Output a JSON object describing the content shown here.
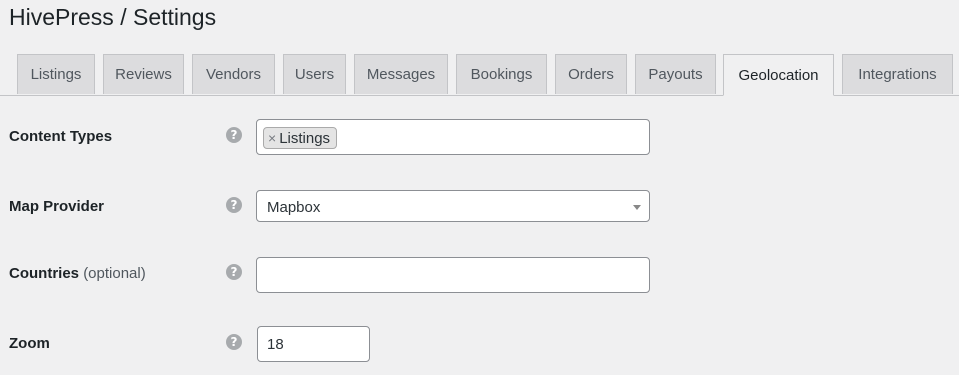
{
  "page": {
    "title": "HivePress / Settings"
  },
  "tabs": [
    {
      "label": "Listings"
    },
    {
      "label": "Reviews"
    },
    {
      "label": "Vendors"
    },
    {
      "label": "Users"
    },
    {
      "label": "Messages"
    },
    {
      "label": "Bookings"
    },
    {
      "label": "Orders"
    },
    {
      "label": "Payouts"
    },
    {
      "label": "Geolocation",
      "active": true
    },
    {
      "label": "Integrations"
    }
  ],
  "fields": {
    "content_types": {
      "label": "Content Types",
      "chips": [
        "Listings"
      ],
      "chip_remove_glyph": "×"
    },
    "map_provider": {
      "label": "Map Provider",
      "value": "Mapbox"
    },
    "countries": {
      "label": "Countries",
      "optional_note": "(optional)",
      "value": ""
    },
    "zoom": {
      "label": "Zoom",
      "value": "18"
    }
  },
  "help_glyph": "?"
}
